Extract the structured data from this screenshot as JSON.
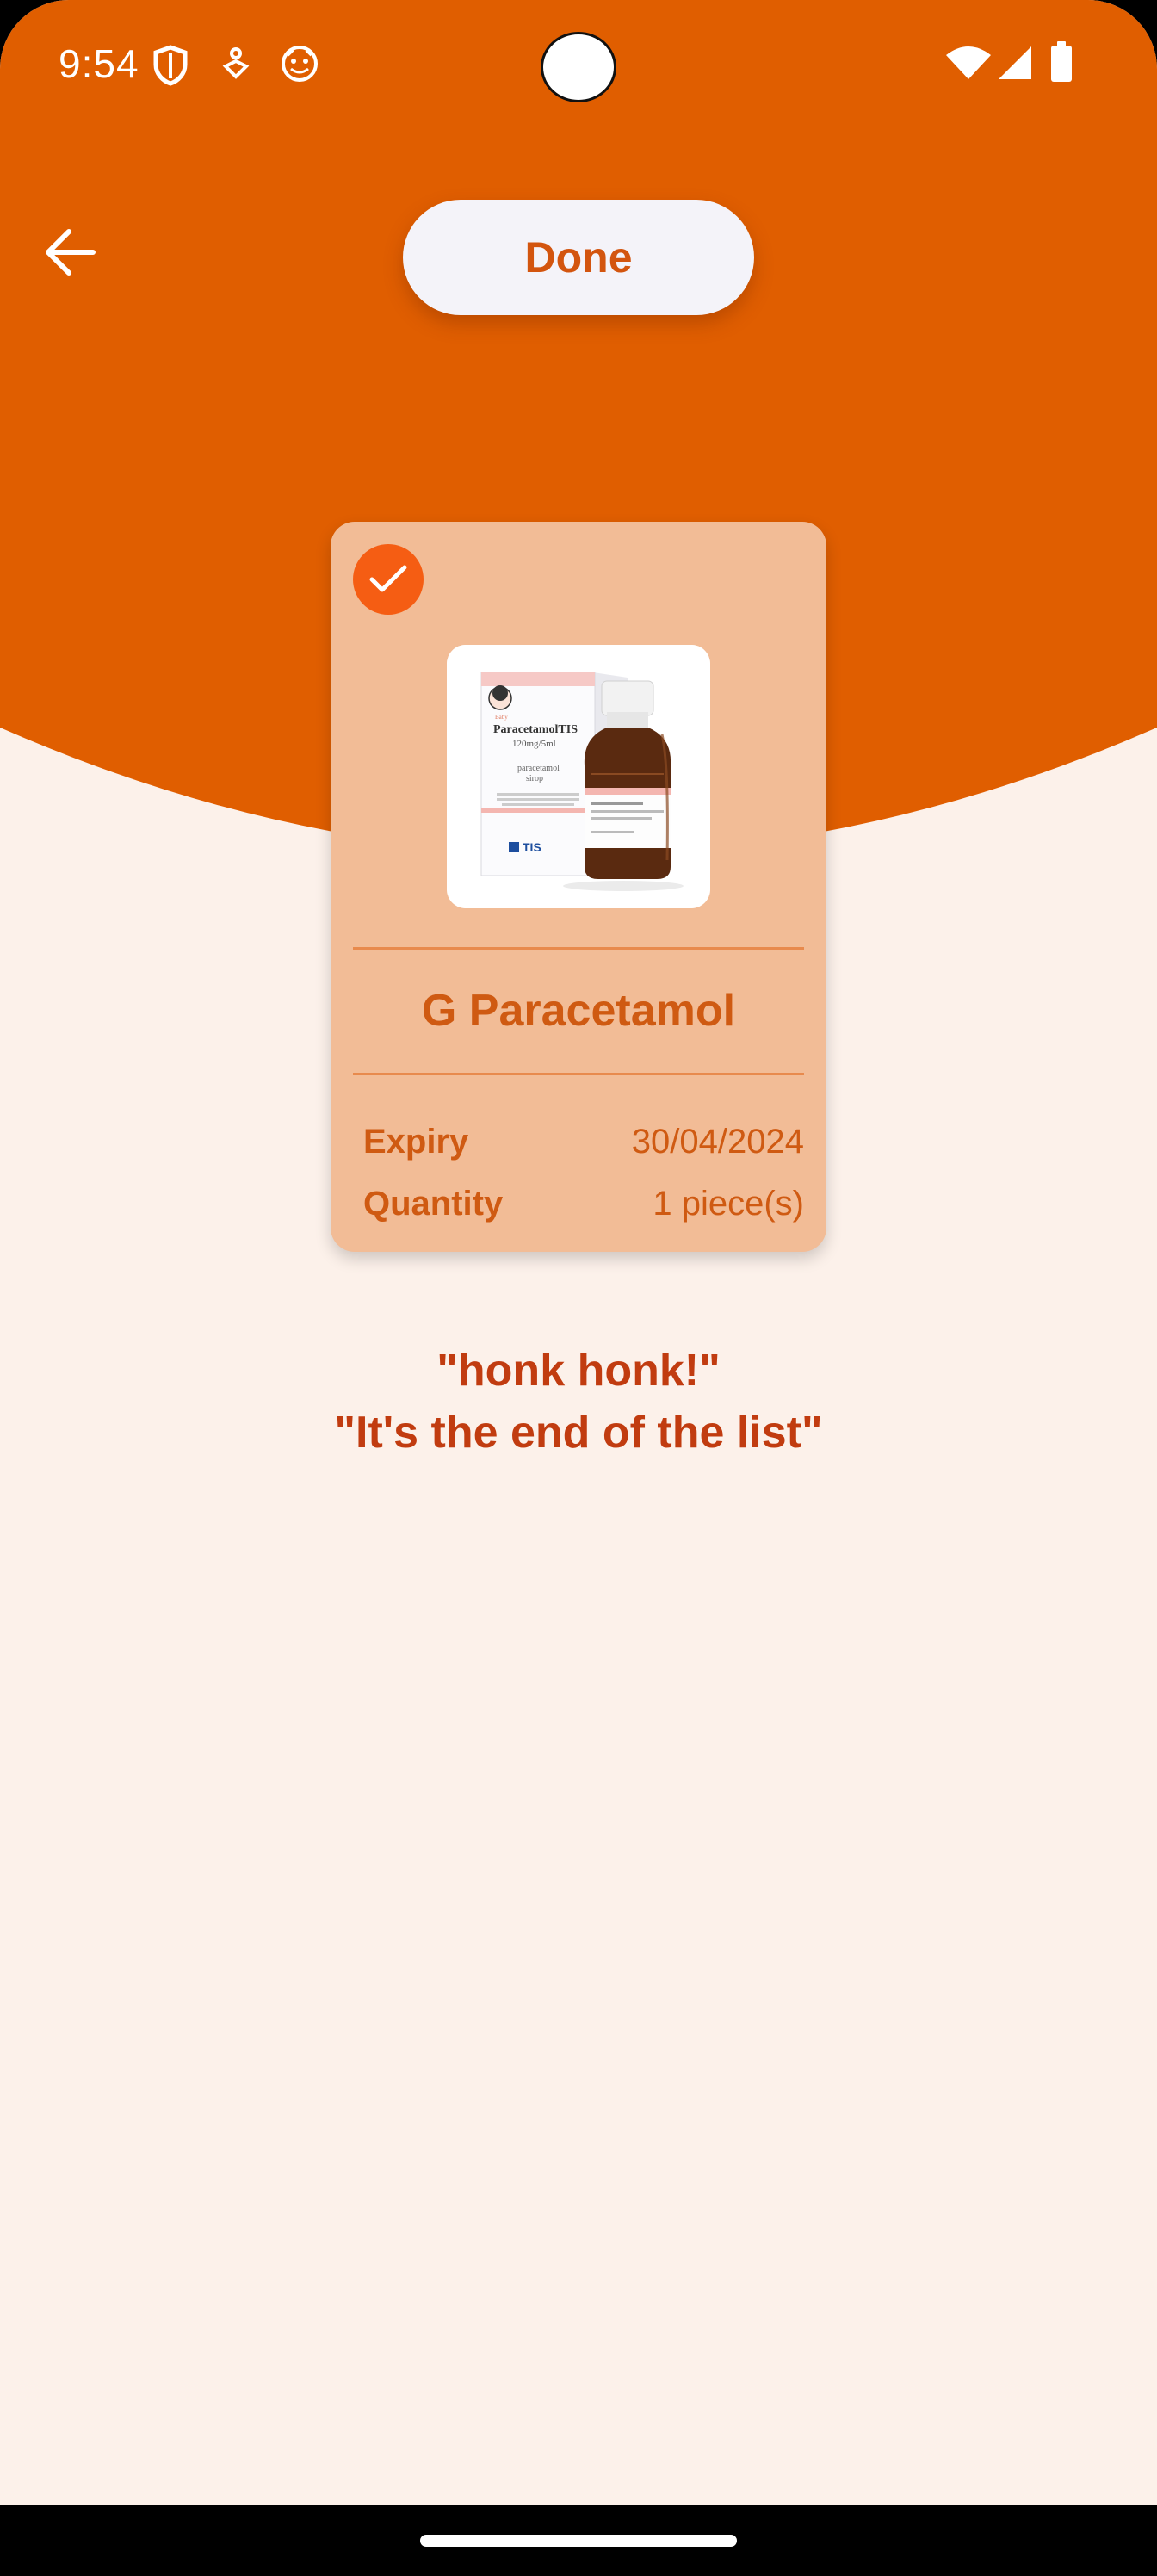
{
  "status_bar": {
    "time": "9:54",
    "icons": [
      "shield-icon",
      "accessibility-icon",
      "face-icon",
      "wifi-icon",
      "signal-icon",
      "battery-icon"
    ]
  },
  "header": {
    "back_icon": "arrow-left-icon",
    "done_label": "Done"
  },
  "colors": {
    "header_orange": "#e05e00",
    "background_cream": "#fcf1ea",
    "card_peach": "#f2bc96",
    "accent_orange": "#f55d13",
    "text_orange": "#cf5a12",
    "message_red": "#c13c10"
  },
  "card": {
    "selected": true,
    "check_icon": "checkmark-icon",
    "image_icon": "paracetamol-syrup-product-image",
    "title": "G Paracetamol",
    "details": [
      {
        "label": "Expiry",
        "value": "30/04/2024"
      },
      {
        "label": "Quantity",
        "value": "1 piece(s)"
      }
    ]
  },
  "message": {
    "line1": "\"honk honk!\"",
    "line2": "\"It's the end of the list\""
  },
  "product_image": {
    "box_brand": "ParacetamolTIS",
    "box_dose": "120mg/5ml",
    "box_generic": "paracetamol",
    "box_form": "sirop",
    "box_maker": "TIS"
  }
}
